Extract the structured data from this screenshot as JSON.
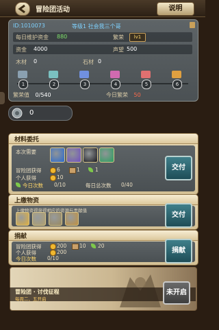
{
  "header": {
    "title": "冒险团活动",
    "explain_label": "说明"
  },
  "guild": {
    "id_label": "ID:1010073",
    "level_text": "等级1 社会我三个哥",
    "daily_fund_label": "每日维护资金",
    "daily_fund_value": "880",
    "prosperity_label": "繁荣",
    "prosperity_level": "lv1",
    "funds_label": "资金",
    "funds_value": "4000",
    "reputation_label": "声望",
    "reputation_value": "500",
    "wood_label": "木材",
    "wood_value": "0",
    "stone_label": "石材",
    "stone_value": "0",
    "milestones": [
      "1",
      "2",
      "3",
      "4",
      "5",
      "6"
    ],
    "chest_colors": [
      "#8aa0b0",
      "#7ac0c0",
      "#7090e0",
      "#d06ab0",
      "#e07070",
      "#e0a040"
    ],
    "prosperity_progress_label": "繁荣值",
    "prosperity_progress_value": "0/540",
    "today_prosperity_label": "今日繁荣",
    "today_prosperity_value": "50",
    "honor_value": "0"
  },
  "sections": {
    "materials": {
      "title": "材料委托",
      "requirement_label": "本次需要",
      "guild_gain_label": "冒险团获得",
      "guild_gain_coin": "6",
      "guild_gain_ticket": "1",
      "guild_gain_leaf": "1",
      "personal_gain_label": "个人获得",
      "personal_gain_value": "10",
      "daily_count_label": "今日次数",
      "daily_count_value": "0/10",
      "total_count_label": "每日总次数",
      "total_count_value": "0/40",
      "button_label": "交付",
      "item_colors": [
        "#2a6ad0",
        "#7050c0",
        "#1a1a20",
        "#2aa060"
      ]
    },
    "submit_goods": {
      "title": "上缴物资",
      "description": "上缴物资得获得相应的资源与贡献值",
      "button_label": "交付",
      "item_colors": [
        "#e0b040",
        "#b0a070",
        "#9a8a60",
        "#c09040"
      ]
    },
    "donate": {
      "title": "捐献",
      "guild_gain_label": "冒险团获得",
      "guild_gain_coin": "200",
      "guild_gain_ticket": "10",
      "guild_gain_leaf": "20",
      "personal_gain_label": "个人获得",
      "personal_gain_value": "200",
      "daily_count_label": "今日次数",
      "daily_count_value": "0/10",
      "total_count_label": "每日总次数",
      "total_count_value": "",
      "button_label": "捐献"
    },
    "expedition": {
      "title": "冒险团 · 讨伐征程",
      "subtitle": "每周二、五开启",
      "button_label": "未开启"
    }
  }
}
